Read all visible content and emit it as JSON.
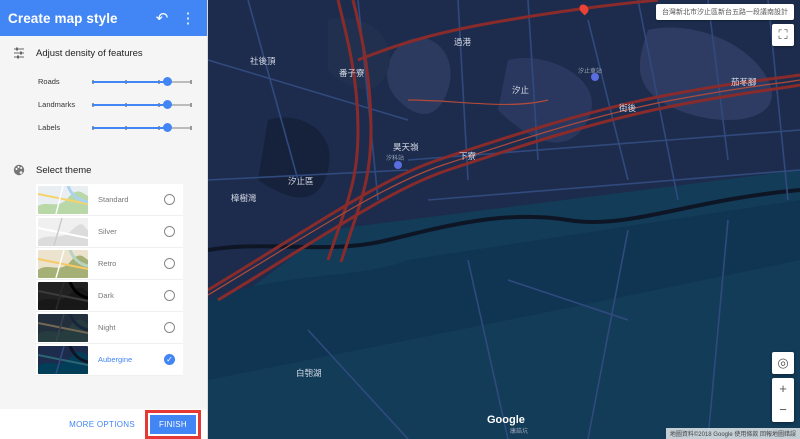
{
  "header": {
    "title": "Create map style"
  },
  "density": {
    "heading": "Adjust density of features",
    "sliders": [
      {
        "label": "Roads",
        "level": 0.75
      },
      {
        "label": "Landmarks",
        "level": 0.75
      },
      {
        "label": "Labels",
        "level": 0.75
      }
    ]
  },
  "theme_section": {
    "heading": "Select theme",
    "themes": [
      {
        "name": "Standard",
        "selected": false
      },
      {
        "name": "Silver",
        "selected": false
      },
      {
        "name": "Retro",
        "selected": false
      },
      {
        "name": "Dark",
        "selected": false
      },
      {
        "name": "Night",
        "selected": false
      },
      {
        "name": "Aubergine",
        "selected": true
      }
    ]
  },
  "footer": {
    "more_options": "MORE OPTIONS",
    "finish": "FINISH"
  },
  "map": {
    "search_text": "台灣新北市汐止區新台五路一段議南設計",
    "labels": [
      "社後頂",
      "番子寮",
      "過港",
      "汐止",
      "汐止車站",
      "茄苳腳",
      "街後",
      "昊天嶺",
      "汐科站",
      "下寮",
      "汐止區",
      "樟樹灣",
      "白匏湖",
      "康誥坑"
    ],
    "google": "Google",
    "attribution": "地圖資料©2018 Google  使用條款  回報地圖錯誤"
  },
  "colors": {
    "accent": "#4285f4",
    "highlight": "#e53935",
    "map_bg": "#1d2c4d",
    "road": "#8a2b2b"
  }
}
